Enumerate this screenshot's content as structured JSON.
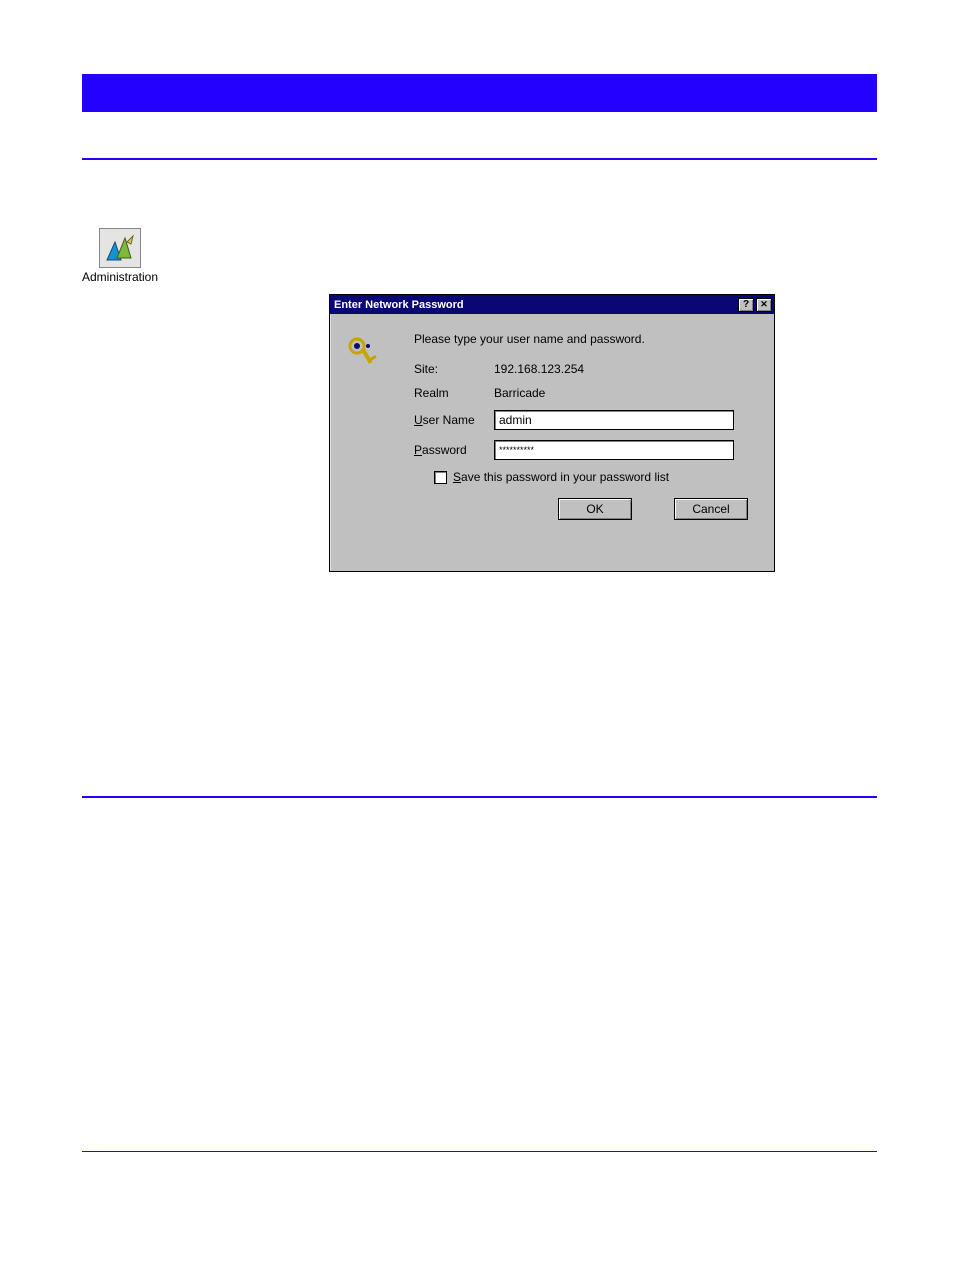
{
  "adminLabel": "Administration",
  "dialog": {
    "title": "Enter Network Password",
    "helpBtn": "?",
    "closeBtn": "✕",
    "prompt": "Please type your user name and password.",
    "siteLabel": "Site:",
    "siteValue": "192.168.123.254",
    "realmLabel": "Realm",
    "realmValue": "Barricade",
    "userLabel_pre": "U",
    "userLabel_rest": "ser Name",
    "userValue": "admin",
    "passLabel_pre": "P",
    "passLabel_rest": "assword",
    "passValue": "**********",
    "saveLabel_pre": "S",
    "saveLabel_rest": "ave this password in your password list",
    "ok": "OK",
    "cancel": "Cancel"
  }
}
